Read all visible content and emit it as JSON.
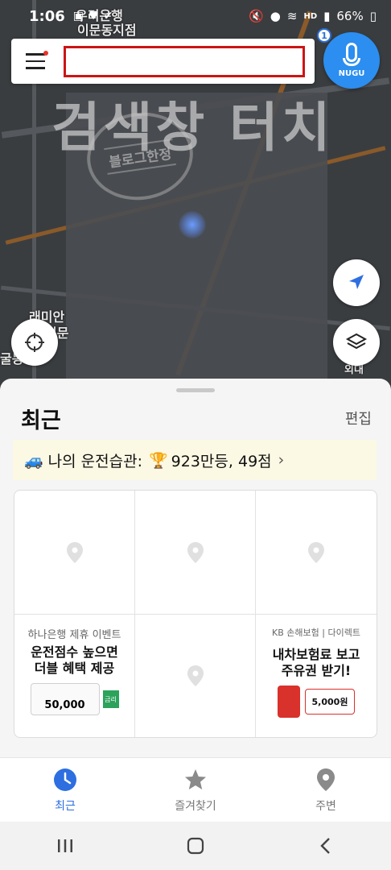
{
  "status_bar": {
    "time": "1:06",
    "battery": "66%",
    "network": "HD"
  },
  "map": {
    "place_labels": [
      "우리은행",
      "이문동지점",
      "래미안",
      "이문",
      "굴동",
      "외대"
    ],
    "overlay_text": "검색창 터치",
    "stamp_text": "블로그한정"
  },
  "search": {
    "placeholder": "",
    "menu_badge_color": "#e8342a",
    "highlight_color": "#cc1414"
  },
  "nugu": {
    "label": "NUGU",
    "badge_count": "1",
    "color": "#2b8ef0"
  },
  "sheet": {
    "title": "최근",
    "edit_label": "편집",
    "habit": {
      "prefix": "나의 운전습관:",
      "rank_icon": "🏆",
      "text": "923만등, 49점",
      "chevron": "›"
    },
    "ads": {
      "hana": {
        "sub": "하나은행 제휴 이벤트",
        "line1": "운전점수 높으면",
        "line2": "더블 혜택 제공",
        "amount": "50,000",
        "tag": "금리"
      },
      "kb": {
        "logo": "KB 손해보험 | 다이렉트",
        "line1": "내차보험료 보고",
        "line2": "주유권 받기!",
        "amount": "5,000원"
      }
    }
  },
  "bottom_nav": {
    "items": [
      {
        "label": "최근",
        "icon": "clock-icon",
        "active": true
      },
      {
        "label": "즐겨찾기",
        "icon": "star-icon",
        "active": false
      },
      {
        "label": "주변",
        "icon": "location-pin-icon",
        "active": false
      }
    ],
    "active_color": "#2d6fe0"
  }
}
